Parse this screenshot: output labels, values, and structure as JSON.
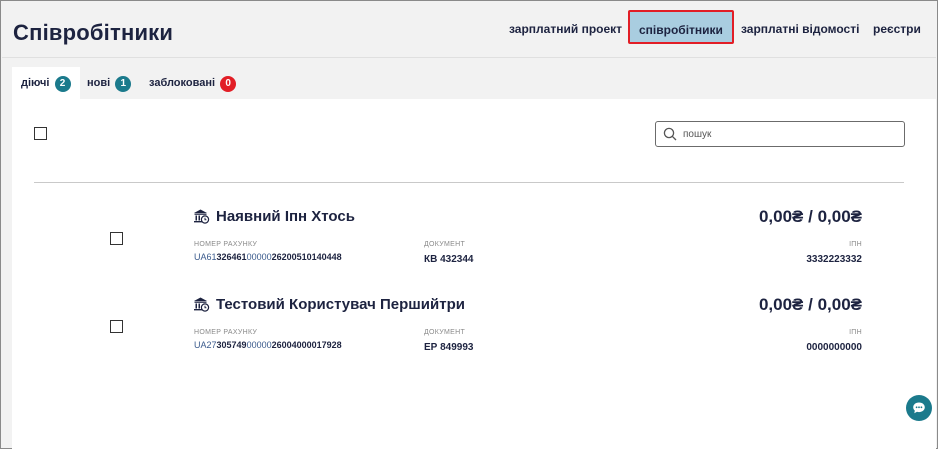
{
  "header": {
    "title": "Співробітники",
    "nav": [
      {
        "label": "зарплатний проект",
        "active": false
      },
      {
        "label": "співробітники",
        "active": true
      },
      {
        "label": "зарплатні відомості",
        "active": false
      },
      {
        "label": "реєстри",
        "active": false
      }
    ]
  },
  "tabs": [
    {
      "label": "діючі",
      "count": "2",
      "badge_color": "#1b7a8c",
      "active": true
    },
    {
      "label": "нові",
      "count": "1",
      "badge_color": "#1b7a8c",
      "active": false
    },
    {
      "label": "заблоковані",
      "count": "0",
      "badge_color": "#e21e26",
      "active": false
    }
  ],
  "search": {
    "placeholder": "пошук",
    "value": ""
  },
  "labels": {
    "account": "НОМЕР РАХУНКУ",
    "document": "ДОКУМЕНТ",
    "inn": "ІПН"
  },
  "employees": [
    {
      "name": "Наявний Іпн Хтось",
      "amount": "0,00₴ / 0,00₴",
      "account_prefix": "UA61",
      "account_bank": "326461",
      "account_mid": "00000",
      "account_rest": "26200510140448",
      "document": "КВ 432344",
      "inn": "3332223332"
    },
    {
      "name": "Тестовий Користувач Першийтри",
      "amount": "0,00₴ / 0,00₴",
      "account_prefix": "UA27",
      "account_bank": "305749",
      "account_mid": "00000",
      "account_rest": "26004000017928",
      "document": "ЕР 849993",
      "inn": "0000000000"
    }
  ],
  "colors": {
    "accent": "#1b7a8c",
    "danger": "#e21e26",
    "active_nav": "#a9cde0",
    "text": "#1d2340"
  },
  "icons": {
    "employee": "bank-person-icon",
    "search": "search-icon",
    "chat": "chat-icon"
  }
}
